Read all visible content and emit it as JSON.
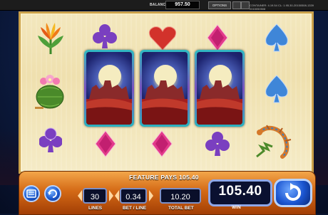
{
  "topbar": {
    "balance_label": "BALANCE",
    "balance_value": "957.50",
    "options_label": "OPTIONS",
    "container_info": "CONTAINER: 4.19.54  CL: 1.95.30-20150508-1339  2015050508"
  },
  "reels": {
    "top_row": [
      "flower-icon",
      "club-icon",
      "heart-icon",
      "diamond-icon",
      "spade-icon"
    ],
    "mid_row": [
      "cactus-icon",
      "stacked-wild",
      "stacked-wild",
      "stacked-wild",
      "spade-icon"
    ],
    "bottom_row": [
      "club-icon",
      "diamond-icon",
      "diamond-icon",
      "club-icon",
      "lizard-icon"
    ],
    "colors": {
      "club": "#7a3fc0",
      "heart": "#d2322b",
      "diamond": "#e23a8a",
      "spade": "#3f86d8"
    }
  },
  "panel": {
    "feature_text": "FEATURE PAYS 105.40",
    "lines_value": "30",
    "lines_label": "LINES",
    "bet_value": "0.34",
    "bet_label": "BET / LINE",
    "total_value": "10.20",
    "total_label": "TOTAL BET",
    "win_value": "105.40",
    "win_label": "WIN"
  }
}
